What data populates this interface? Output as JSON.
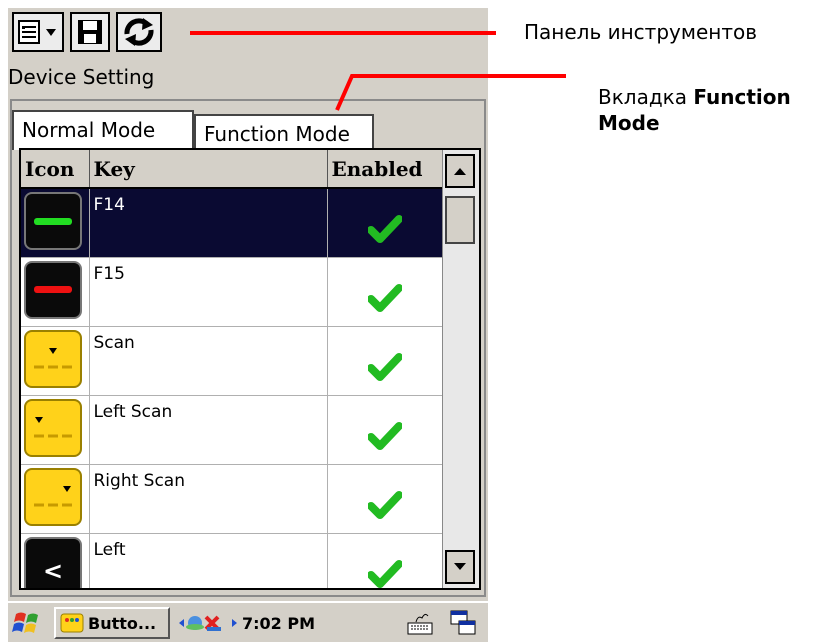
{
  "toolbar": {
    "label": "Панель инструментов"
  },
  "app_title": "Device Setting",
  "tabs": [
    {
      "label": "Normal Mode"
    },
    {
      "label": "Function Mode"
    }
  ],
  "tab_callout": {
    "prefix": "Вкладка ",
    "bold_line1": "Function",
    "bold_line2": "Mode"
  },
  "columns": {
    "icon": "Icon",
    "key": "Key",
    "enabled": "Enabled"
  },
  "rows": [
    {
      "key": "F14",
      "icon": "green-bar-key-icon",
      "enabled": true
    },
    {
      "key": "F15",
      "icon": "red-bar-key-icon",
      "enabled": true
    },
    {
      "key": "Scan",
      "icon": "scan-key-icon",
      "enabled": true
    },
    {
      "key": "Left Scan",
      "icon": "left-scan-key-icon",
      "enabled": true
    },
    {
      "key": "Right Scan",
      "icon": "right-scan-key-icon",
      "enabled": true
    },
    {
      "key": "Left",
      "icon": "left-arrow-key-icon",
      "enabled": true
    }
  ],
  "taskbar": {
    "app_label": "Butto...",
    "time": "7:02 PM"
  },
  "colors": {
    "callout": "#ff0000",
    "selection": "#0a0a32",
    "check": "#22bb22",
    "green_bar": "#22dd22",
    "red_bar": "#ee1111",
    "key_yellow": "#ffd21a"
  }
}
